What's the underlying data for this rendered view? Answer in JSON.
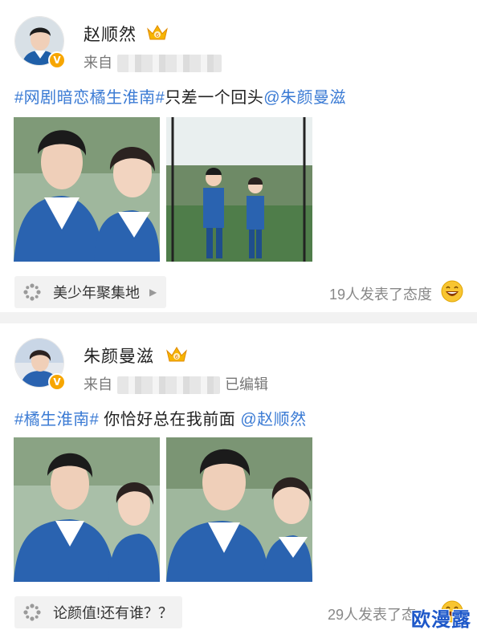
{
  "posts": [
    {
      "username": "赵顺然",
      "source_prefix": "来自",
      "text": {
        "topic": "#网剧暗恋橘生淮南#",
        "body": "只差一个回头",
        "mention": "@朱颜曼滋"
      },
      "group_chip": "美少年聚集地",
      "reaction_text": "19人发表了态度"
    },
    {
      "username": "朱颜曼滋",
      "source_prefix": "来自",
      "edited": "已编辑",
      "text": {
        "topic": "#橘生淮南#",
        "body": " 你恰好总在我前面 ",
        "mention": "@赵顺然"
      },
      "group_chip": "论颜值!还有谁？？",
      "reaction_text": "29人发表了态"
    }
  ],
  "verified_badge": "V",
  "watermark": "欧漫露",
  "colors": {
    "link": "#3b7bd4",
    "badge": "#f7a600",
    "divider": "#f2f2f2"
  },
  "icons": [
    "verified-badge-icon",
    "crown-vip-icon",
    "group-icon",
    "chevron-right-icon",
    "laughing-emoji-icon"
  ]
}
